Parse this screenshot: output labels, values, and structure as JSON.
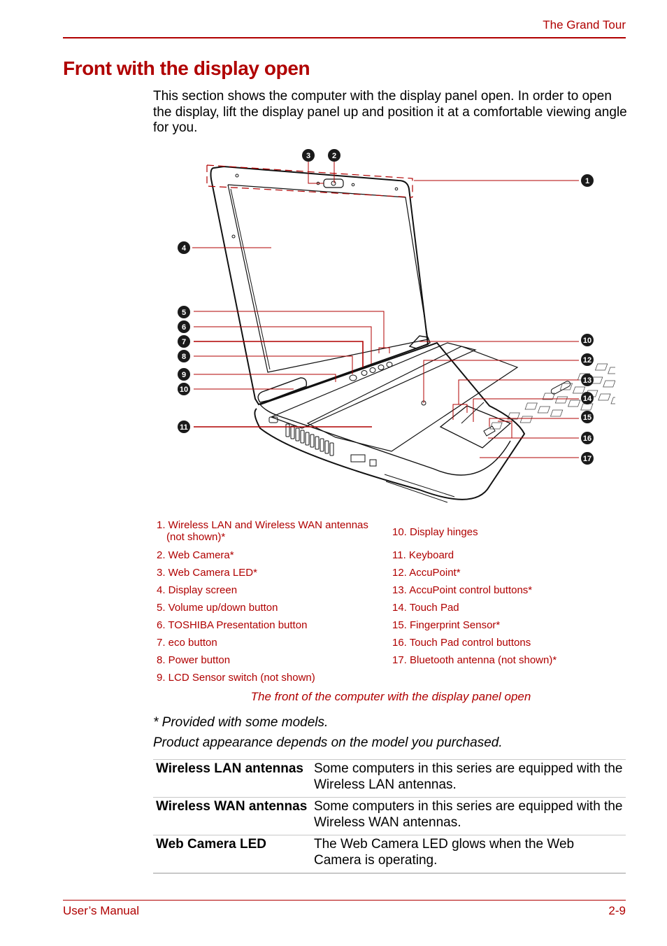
{
  "header": {
    "chapter": "The Grand Tour"
  },
  "page_title": "Front with the display open",
  "intro": "This section shows the computer with the display panel open. In order to open the display, lift the display panel up and position it at a comfortable viewing angle for you.",
  "figure": {
    "callouts": [
      "1",
      "2",
      "3",
      "4",
      "5",
      "6",
      "7",
      "8",
      "9",
      "10",
      "10",
      "11",
      "12",
      "13",
      "14",
      "15",
      "16",
      "17"
    ],
    "legend_left": [
      {
        "line1": "1. Wireless LAN and Wireless WAN antennas",
        "line2": "(not shown)*"
      },
      {
        "line1": "2. Web Camera*"
      },
      {
        "line1": "3. Web Camera LED*"
      },
      {
        "line1": "4. Display screen"
      },
      {
        "line1": "5. Volume up/down button"
      },
      {
        "line1": "6. TOSHIBA Presentation button"
      },
      {
        "line1": "7. eco button"
      },
      {
        "line1": "8. Power button"
      },
      {
        "line1": "9. LCD Sensor switch (not shown)"
      }
    ],
    "legend_right": [
      "10. Display hinges",
      "11. Keyboard",
      "12. AccuPoint*",
      "13. AccuPoint control buttons*",
      "14. Touch Pad",
      "15. Fingerprint Sensor*",
      "16. Touch Pad control buttons",
      "17. Bluetooth antenna (not shown)*"
    ],
    "caption": "The front of the computer with the display panel open"
  },
  "notes": {
    "provided": "* Provided with some models.",
    "appearance": "Product appearance depends on the model you purchased."
  },
  "definitions": [
    {
      "term": "Wireless LAN antennas",
      "desc": "Some computers in this series are equipped with the Wireless LAN antennas."
    },
    {
      "term": "Wireless WAN antennas",
      "desc": "Some computers in this series are equipped with the Wireless WAN antennas."
    },
    {
      "term": "Web Camera LED",
      "desc": "The Web Camera LED glows when the Web Camera is operating."
    }
  ],
  "footer": {
    "left": "User’s Manual",
    "right": "2-9"
  },
  "colors": {
    "accent": "#b00000",
    "callout_fill": "#1a1a1a",
    "rule_gray": "#c8c8c8"
  }
}
